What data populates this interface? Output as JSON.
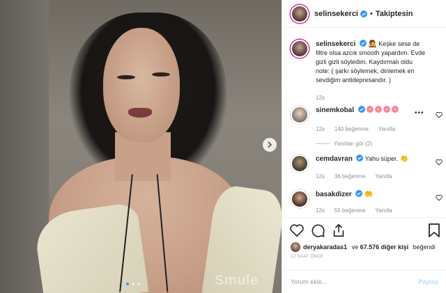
{
  "media": {
    "watermark": "Smule",
    "next_icon": "chevron-right-icon",
    "dots_count": 3
  },
  "header": {
    "username": "selinsekerci",
    "separator": "•",
    "follow_label": "Takiptesin"
  },
  "caption": {
    "username": "selinsekerci",
    "text": "Keşke sese de filtre olsa azcık smooth yapardım. Evde gizli gizli söyledim. Kaydırmalı oldu note: ( şarkı söylemek, dinlemek en sevdiğim antidepresandır. )",
    "time": "12s"
  },
  "comments": [
    {
      "username": "sinemkobal",
      "text": "",
      "time": "12s",
      "likes": "140 beğenme",
      "reply": "Yanıtla",
      "replies_link": "Yanıtları gör (2)"
    },
    {
      "username": "cemdavran",
      "text": "Yahu süper.",
      "time": "12s",
      "likes": "36 beğenme",
      "reply": "Yanıtla"
    },
    {
      "username": "basakdizer",
      "text": "",
      "time": "12s",
      "likes": "55 beğenme",
      "reply": "Yanıtla"
    }
  ],
  "likes_line": {
    "user": "deryakaradas1",
    "middle": " ve ",
    "count": "67.576 diğer kişi",
    "suffix": " beğendi"
  },
  "timestamp": "12 SAAT ÖNCE",
  "add_comment": {
    "placeholder": "Yorum ekle...",
    "share_label": "Paylaş"
  },
  "colors": {
    "verified": "#3897f0",
    "share_disabled": "#b2dffc",
    "muted": "#8e8e8e"
  }
}
